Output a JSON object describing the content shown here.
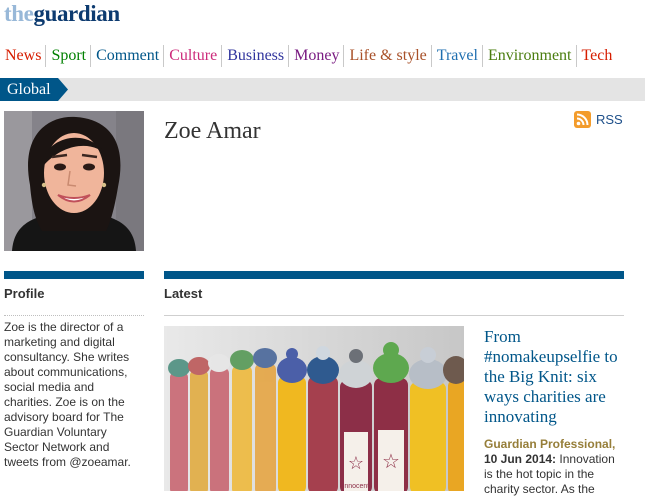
{
  "site": {
    "logo_the": "the",
    "logo_name": "guardian"
  },
  "nav": {
    "items": [
      {
        "label": "News",
        "color": "#d61d00"
      },
      {
        "label": "Sport",
        "color": "#008000"
      },
      {
        "label": "Comment",
        "color": "#005689"
      },
      {
        "label": "Culture",
        "color": "#cc2b7b"
      },
      {
        "label": "Business",
        "color": "#31359e"
      },
      {
        "label": "Money",
        "color": "#7a1c82"
      },
      {
        "label": "Life & style",
        "color": "#a85028"
      },
      {
        "label": "Travel",
        "color": "#1f6fb0"
      },
      {
        "label": "Environment",
        "color": "#4a7d0e"
      },
      {
        "label": "Tech",
        "color": "#d61d00"
      }
    ]
  },
  "section": {
    "label": "Global"
  },
  "author": {
    "name": "Zoe Amar"
  },
  "rss": {
    "label": "RSS",
    "icon": "rss-icon"
  },
  "profile": {
    "title": "Profile",
    "bio": "Zoe is the director of a marketing and digital consultancy. She writes about communications, social media and charities. Zoe is on the advisory board for The Guardian Voluntary Sector Network and tweets from @zoeamar."
  },
  "latest": {
    "title": "Latest",
    "story": {
      "headline": "From #nomakeupselfie to the Big Knit: six ways charities are innovating",
      "source": "Guardian Professional,",
      "date": "10 Jun 2014:",
      "standfirst": " Innovation is the hot topic in the charity sector. As the",
      "bottle_label": "innocent"
    }
  }
}
